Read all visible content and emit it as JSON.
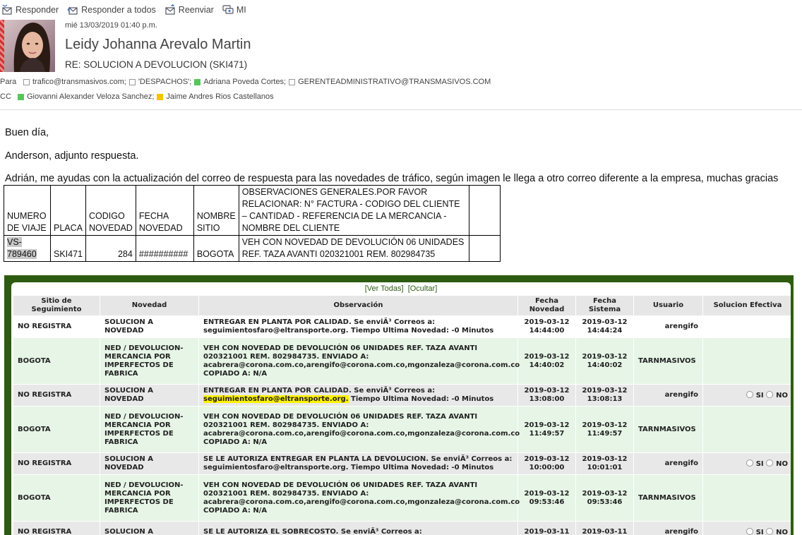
{
  "toolbar": {
    "reply": "Responder",
    "reply_all": "Responder a todos",
    "forward": "Reenviar",
    "im": "MI"
  },
  "header": {
    "date": "mié 13/03/2019 01:40 p.m.",
    "sender": "Leidy Johanna Arevalo Martin",
    "subject": "RE: SOLUCION A DEVOLUCION (SKI471)",
    "to_label": "Para",
    "to": [
      "trafico@transmasivos.com;",
      "'DESPACHOS';",
      "Adriana Poveda Cortes;",
      "GERENTEADMINISTRATIVO@TRANSMASIVOS.COM"
    ],
    "cc_label": "CC",
    "cc": [
      "Giovanni Alexander Veloza Sanchez;",
      "Jaime Andres Rios Castellanos"
    ]
  },
  "body": {
    "greeting": "Buen día,",
    "line1": "Anderson, adjunto respuesta.",
    "line2": "Adrián, me ayudas con la actualización del correo de respuesta para las novedades de tráfico, según imagen le llega a otro correo diferente a la empresa, muchas gracias"
  },
  "excel": {
    "headers": [
      "NUMERO DE VIAJE",
      "PLACA",
      "CODIGO NOVEDAD",
      "FECHA NOVEDAD",
      "NOMBRE SITIO",
      "OBSERVACIONES GENERALES.POR FAVOR RELACIONAR: N° FACTURA - CODIGO DEL CLIENTE – CANTIDAD - REFERENCIA DE LA MERCANCIA - NOMBRE DEL CLIENTE"
    ],
    "row": [
      "VS-789460",
      "SKI471",
      "284",
      "##########",
      "BOGOTA",
      "VEH CON NOVEDAD DE DEVOLUCIÓN 06 UNIDADES REF. TAZA AVANTI 020321001 REM. 802984735"
    ]
  },
  "tracking": {
    "ver_todas": "[Ver Todas]",
    "ocultar": "[Ocultar]",
    "headers": [
      "Sitio de Seguimiento",
      "Novedad",
      "Observación",
      "Fecha Novedad",
      "Fecha Sistema",
      "Usuario",
      "Solucion Efectiva"
    ],
    "radio_si": "SI",
    "radio_no": "NO",
    "highlight_email": "seguimientosfaro@eltransporte.org.",
    "rows": [
      {
        "sitio": "NO REGISTRA",
        "novedad": "SOLUCION A NOVEDAD",
        "obs": "ENTREGAR EN PLANTA POR CALIDAD. Se enviÃ³ Correos a: seguimientosfaro@eltransporte.org. Tiempo Ultima Novedad: -0 Minutos",
        "fn": "2019-03-12 14:44:00",
        "fs": "2019-03-12 14:44:24",
        "usuario": "arengifo"
      },
      {
        "sitio": "BOGOTA",
        "novedad": "NED / DEVOLUCION-MERCANCIA POR IMPERFECTOS DE FABRICA",
        "obs": "VEH CON NOVEDAD DE DEVOLUCIÓN 06 UNIDADES REF. TAZA AVANTI 020321001 REM. 802984735. ENVIADO A: acabrera@corona.com.co,arengifo@corona.com.co,mgonzaleza@corona.com.co COPIADO A: N/A",
        "fn": "2019-03-12 14:40:02",
        "fs": "2019-03-12 14:40:02",
        "usuario": "TARNMASIVOS"
      },
      {
        "sitio": "NO REGISTRA",
        "novedad": "SOLUCION A NOVEDAD",
        "obs_pre": "ENTREGAR EN PLANTA POR CALIDAD. Se enviÃ³ Correos a:",
        "obs_post": "Tiempo Ultima Novedad: -0 Minutos",
        "fn": "2019-03-12 13:08:00",
        "fs": "2019-03-12 13:08:13",
        "usuario": "arengifo"
      },
      {
        "sitio": "BOGOTA",
        "novedad": "NED / DEVOLUCION-MERCANCIA POR IMPERFECTOS DE FABRICA",
        "obs": "VEH CON NOVEDAD DE DEVOLUCIÓN 06 UNIDADES REF. TAZA AVANTI 020321001 REM. 802984735. ENVIADO A: acabrera@corona.com.co,arengifo@corona.com.co,mgonzaleza@corona.com.co COPIADO A: N/A",
        "fn": "2019-03-12 11:49:57",
        "fs": "2019-03-12 11:49:57",
        "usuario": "TARNMASIVOS"
      },
      {
        "sitio": "NO REGISTRA",
        "novedad": "SOLUCION A NOVEDAD",
        "obs": "SE LE AUTORIZA ENTREGAR EN PLANTA LA DEVOLUCION. Se enviÃ³ Correos a: seguimientosfaro@eltransporte.org. Tiempo Ultima Novedad: -0 Minutos",
        "fn": "2019-03-12 10:00:00",
        "fs": "2019-03-12 10:01:01",
        "usuario": "arengifo"
      },
      {
        "sitio": "BOGOTA",
        "novedad": "NED / DEVOLUCION-MERCANCIA POR IMPERFECTOS DE FABRICA",
        "obs": "VEH CON NOVEDAD DE DEVOLUCIÓN 06 UNIDADES REF. TAZA AVANTI 020321001 REM. 802984735. ENVIADO A: acabrera@corona.com.co,arengifo@corona.com.co,mgonzaleza@corona.com.co COPIADO A: N/A",
        "fn": "2019-03-12 09:53:46",
        "fs": "2019-03-12 09:53:46",
        "usuario": "TARNMASIVOS"
      },
      {
        "sitio": "NO REGISTRA",
        "novedad": "SOLUCION A",
        "obs": "SE LE AUTORIZA EL SOBRECOSTO. Se enviÃ³ Correos a:",
        "fn": "2019-03-11",
        "fs": "2019-03-11",
        "usuario": "arengifo"
      }
    ]
  }
}
